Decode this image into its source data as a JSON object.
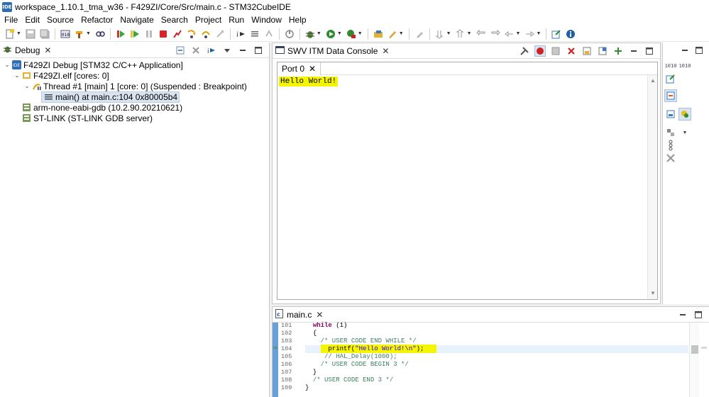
{
  "window": {
    "title": "workspace_1.10.1_tma_w36 - F429ZI/Core/Src/main.c - STM32CubeIDE",
    "app_icon_text": "IDE"
  },
  "menu": [
    "File",
    "Edit",
    "Source",
    "Refactor",
    "Navigate",
    "Search",
    "Project",
    "Run",
    "Window",
    "Help"
  ],
  "debug_view": {
    "tab_label": "Debug",
    "tree": [
      {
        "label": "F429ZI Debug [STM32 C/C++ Application]",
        "level": 0,
        "expanded": true,
        "icon": "ide-launch-icon"
      },
      {
        "label": "F429ZI.elf [cores: 0]",
        "level": 1,
        "expanded": true,
        "icon": "elf-process-icon"
      },
      {
        "label": "Thread #1 [main] 1 [core: 0] (Suspended : Breakpoint)",
        "level": 2,
        "expanded": true,
        "icon": "thread-suspended-icon"
      },
      {
        "label": "main() at main.c:104 0x80005b4",
        "level": 3,
        "expanded": null,
        "icon": "stack-frame-icon",
        "selected": true
      },
      {
        "label": "arm-none-eabi-gdb (10.2.90.20210621)",
        "level": 1,
        "expanded": null,
        "icon": "gdb-process-icon"
      },
      {
        "label": "ST-LINK (ST-LINK GDB server)",
        "level": 1,
        "expanded": null,
        "icon": "stlink-process-icon"
      }
    ]
  },
  "console_view": {
    "tab_label": "SWV ITM Data Console",
    "port_tab": "Port 0",
    "output": "Hello World!"
  },
  "editor": {
    "tab_label": "main.c",
    "lines": [
      {
        "num": "101",
        "indent": "  ",
        "parts": [
          {
            "t": "while",
            "c": "kw"
          },
          {
            "t": " (1)",
            "c": ""
          }
        ]
      },
      {
        "num": "102",
        "indent": "  ",
        "parts": [
          {
            "t": "{",
            "c": ""
          }
        ]
      },
      {
        "num": "103",
        "indent": "    ",
        "parts": [
          {
            "t": "/* USER CODE END WHILE */",
            "c": "cm"
          }
        ]
      },
      {
        "num": "104",
        "indent": "      ",
        "parts": [
          {
            "t": "printf(",
            "c": ""
          },
          {
            "t": "\"Hello World!\\n\"",
            "c": "str"
          },
          {
            "t": ");",
            "c": ""
          }
        ],
        "current": true,
        "highlight": true
      },
      {
        "num": "105",
        "indent": "     ",
        "parts": [
          {
            "t": "// HAL_Delay(1000);",
            "c": "cm"
          }
        ]
      },
      {
        "num": "106",
        "indent": "    ",
        "parts": [
          {
            "t": "/* USER CODE BEGIN 3 */",
            "c": "cm"
          }
        ]
      },
      {
        "num": "107",
        "indent": "  ",
        "parts": [
          {
            "t": "}",
            "c": ""
          }
        ]
      },
      {
        "num": "108",
        "indent": "  ",
        "parts": [
          {
            "t": "/* USER CODE END 3 */",
            "c": "cm"
          }
        ]
      },
      {
        "num": "109",
        "indent": "",
        "parts": [
          {
            "t": "}",
            "c": ""
          }
        ]
      }
    ]
  },
  "right_trim": {
    "label_a": "1010",
    "label_b": "1010"
  },
  "colors": {
    "highlight": "#f5f500",
    "selection": "#d9e4f0",
    "gutter": "#6aa0d8",
    "keyword": "#7f0055",
    "comment": "#3f7f5f",
    "string": "#2a00ff"
  }
}
